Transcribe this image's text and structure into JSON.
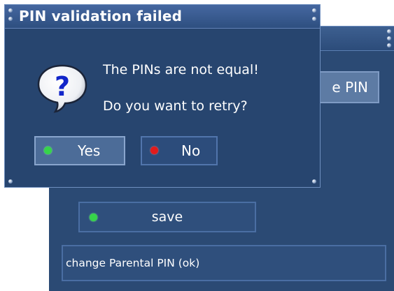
{
  "background_window": {
    "ghost_button_label": "e PIN",
    "save_button": {
      "label": "save",
      "indicator_color": "#36d44a"
    },
    "status_text": "change Parental PIN (ok)"
  },
  "dialog": {
    "title": "PIN validation failed",
    "icon": "question-mark-speech-bubble-icon",
    "message_line1": "The PINs are not equal!",
    "message_line2": "Do you want to retry?",
    "buttons": [
      {
        "label": "Yes",
        "indicator_color": "#36d44a",
        "selected": true
      },
      {
        "label": "No",
        "indicator_color": "#e21b1b",
        "selected": false
      }
    ]
  },
  "colors": {
    "window_bg": "#27456f",
    "titlebar": "#4567a0",
    "focused_button": "#4c6c98"
  }
}
